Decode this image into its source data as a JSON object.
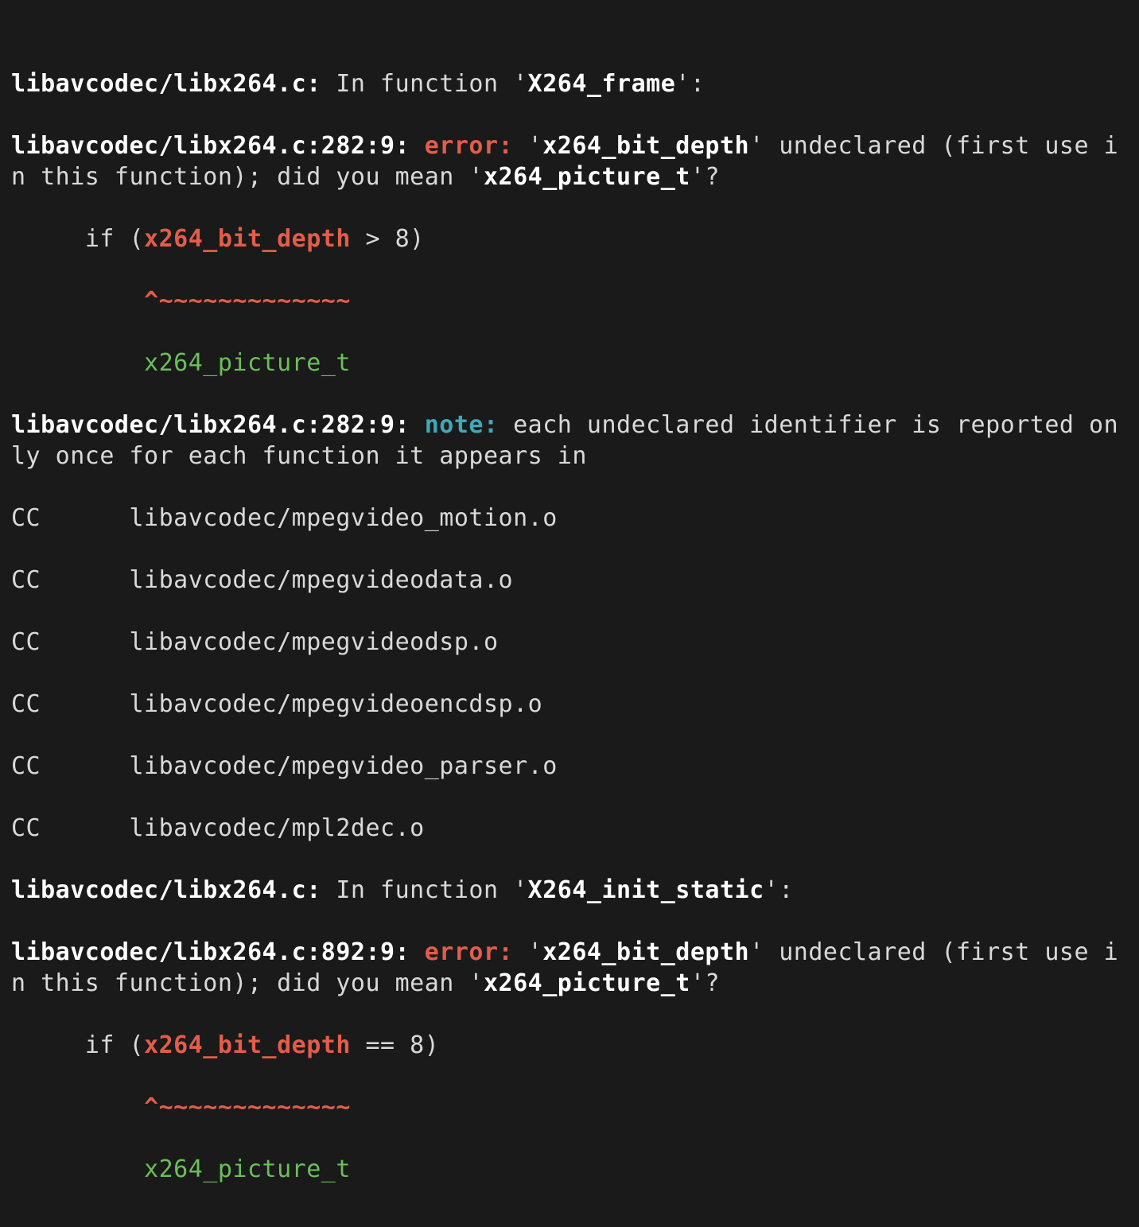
{
  "colors": {
    "background": "#1a1a1a",
    "default_text": "#d9d9d9",
    "bold_text": "#ffffff",
    "error": "#e25d4a",
    "note": "#3fa9b9",
    "fixit": "#6bbf59"
  },
  "block1": {
    "file_context": "libavcodec/libx264.c:",
    "in_fn_prefix": " In function '",
    "fn_name": "X264_frame",
    "in_fn_suffix": "':",
    "loc": "libavcodec/libx264.c:282:9: ",
    "error_label": "error: ",
    "msg_prefix": "'",
    "undeclared_id": "x264_bit_depth",
    "msg_mid": "' undeclared (first use in this function); did you mean '",
    "suggested_id": "x264_picture_t",
    "msg_suffix": "'?",
    "src_indent": "     ",
    "src_pre": "if (",
    "src_id": "x264_bit_depth",
    "src_post": " > 8)",
    "caret_indent": "         ",
    "caret": "^~~~~~~~~~~~~~",
    "fixit_indent": "         ",
    "fixit": "x264_picture_t",
    "note_loc": "libavcodec/libx264.c:282:9: ",
    "note_label": "note:",
    "note_text": " each undeclared identifier is reported only once for each function it appears in"
  },
  "cc_lines": [
    {
      "label": "CC",
      "sep": "      ",
      "obj": "libavcodec/mpegvideo_motion.o"
    },
    {
      "label": "CC",
      "sep": "      ",
      "obj": "libavcodec/mpegvideodata.o"
    },
    {
      "label": "CC",
      "sep": "      ",
      "obj": "libavcodec/mpegvideodsp.o"
    },
    {
      "label": "CC",
      "sep": "      ",
      "obj": "libavcodec/mpegvideoencdsp.o"
    },
    {
      "label": "CC",
      "sep": "      ",
      "obj": "libavcodec/mpegvideo_parser.o"
    },
    {
      "label": "CC",
      "sep": "      ",
      "obj": "libavcodec/mpl2dec.o"
    }
  ],
  "block2": {
    "file_context": "libavcodec/libx264.c:",
    "in_fn_prefix": " In function '",
    "fn_name": "X264_init_static",
    "in_fn_suffix": "':",
    "loc": "libavcodec/libx264.c:892:9: ",
    "error_label": "error: ",
    "msg_prefix": "'",
    "undeclared_id": "x264_bit_depth",
    "msg_mid": "' undeclared (first use in this function); did you mean '",
    "suggested_id": "x264_picture_t",
    "msg_suffix": "'?",
    "src_indent": "     ",
    "src_pre": "if (",
    "src_id": "x264_bit_depth",
    "src_post": " == 8)",
    "caret_indent": "         ",
    "caret": "^~~~~~~~~~~~~~",
    "fixit_indent": "         ",
    "fixit": "x264_picture_t"
  }
}
